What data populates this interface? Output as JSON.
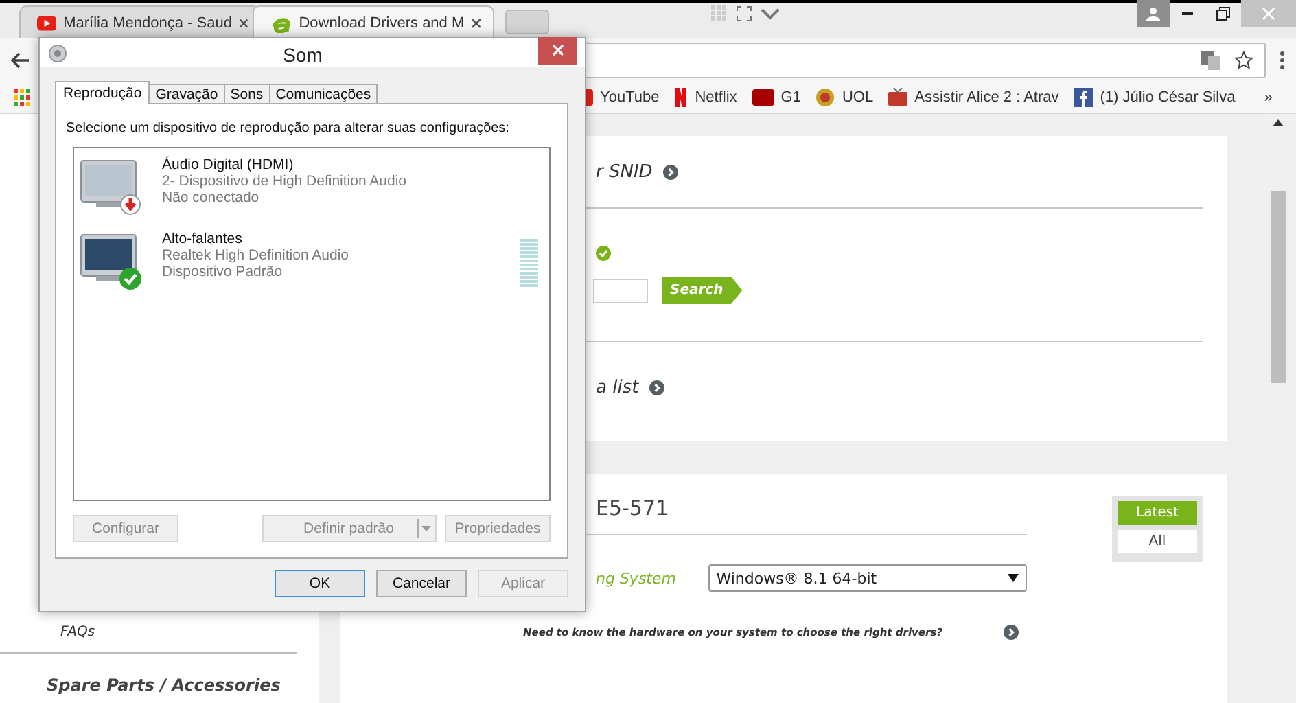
{
  "browser": {
    "tabs": [
      {
        "title": "Marília Mendonça - Saud",
        "selected": false
      },
      {
        "title": "Download Drivers and M",
        "selected": true
      }
    ],
    "bookmarks": [
      {
        "label": "YouTube"
      },
      {
        "label": "Netflix"
      },
      {
        "label": "G1"
      },
      {
        "label": "UOL"
      },
      {
        "label": "Assistir Alice 2 : Atrav"
      },
      {
        "label": "(1) Júlio César Silva"
      }
    ],
    "bookmarks_more": "»"
  },
  "page": {
    "sidebar": {
      "link": "FAQs",
      "heading": "Spare Parts / Accessories"
    },
    "finder": {
      "serial_link": "r SNID",
      "search_button": "Search",
      "list_link": "a list"
    },
    "product": {
      "model": "E5-571",
      "os_label": "ng System",
      "os_value": "Windows® 8.1 64-bit",
      "hint": "Need to know the hardware on your system to choose the right drivers?",
      "filters": [
        {
          "label": "Latest",
          "selected": true
        },
        {
          "label": "All",
          "selected": false
        }
      ]
    }
  },
  "dialog": {
    "title": "Som",
    "tabs": [
      {
        "label": "Reprodução",
        "selected": true
      },
      {
        "label": "Gravação",
        "selected": false
      },
      {
        "label": "Sons",
        "selected": false
      },
      {
        "label": "Comunicações",
        "selected": false
      }
    ],
    "instruction": "Selecione um dispositivo de reprodução para alterar suas configurações:",
    "devices": [
      {
        "name": "Áudio Digital (HDMI)",
        "driver": "2- Dispositivo de High Definition Audio",
        "status": "Não conectado",
        "connected": false,
        "default": false
      },
      {
        "name": "Alto-falantes",
        "driver": "Realtek High Definition Audio",
        "status": "Dispositivo Padrão",
        "connected": true,
        "default": true,
        "level": 0
      }
    ],
    "device_buttons": [
      {
        "label": "Configurar",
        "disabled": true,
        "kind": "plain"
      },
      {
        "label": "Definir padrão",
        "disabled": true,
        "kind": "split"
      },
      {
        "label": "Propriedades",
        "disabled": true,
        "kind": "plain"
      }
    ],
    "buttons": [
      {
        "label": "OK",
        "disabled": false,
        "focused": true
      },
      {
        "label": "Cancelar",
        "disabled": false,
        "focused": false
      },
      {
        "label": "Aplicar",
        "disabled": true,
        "focused": false
      }
    ]
  }
}
